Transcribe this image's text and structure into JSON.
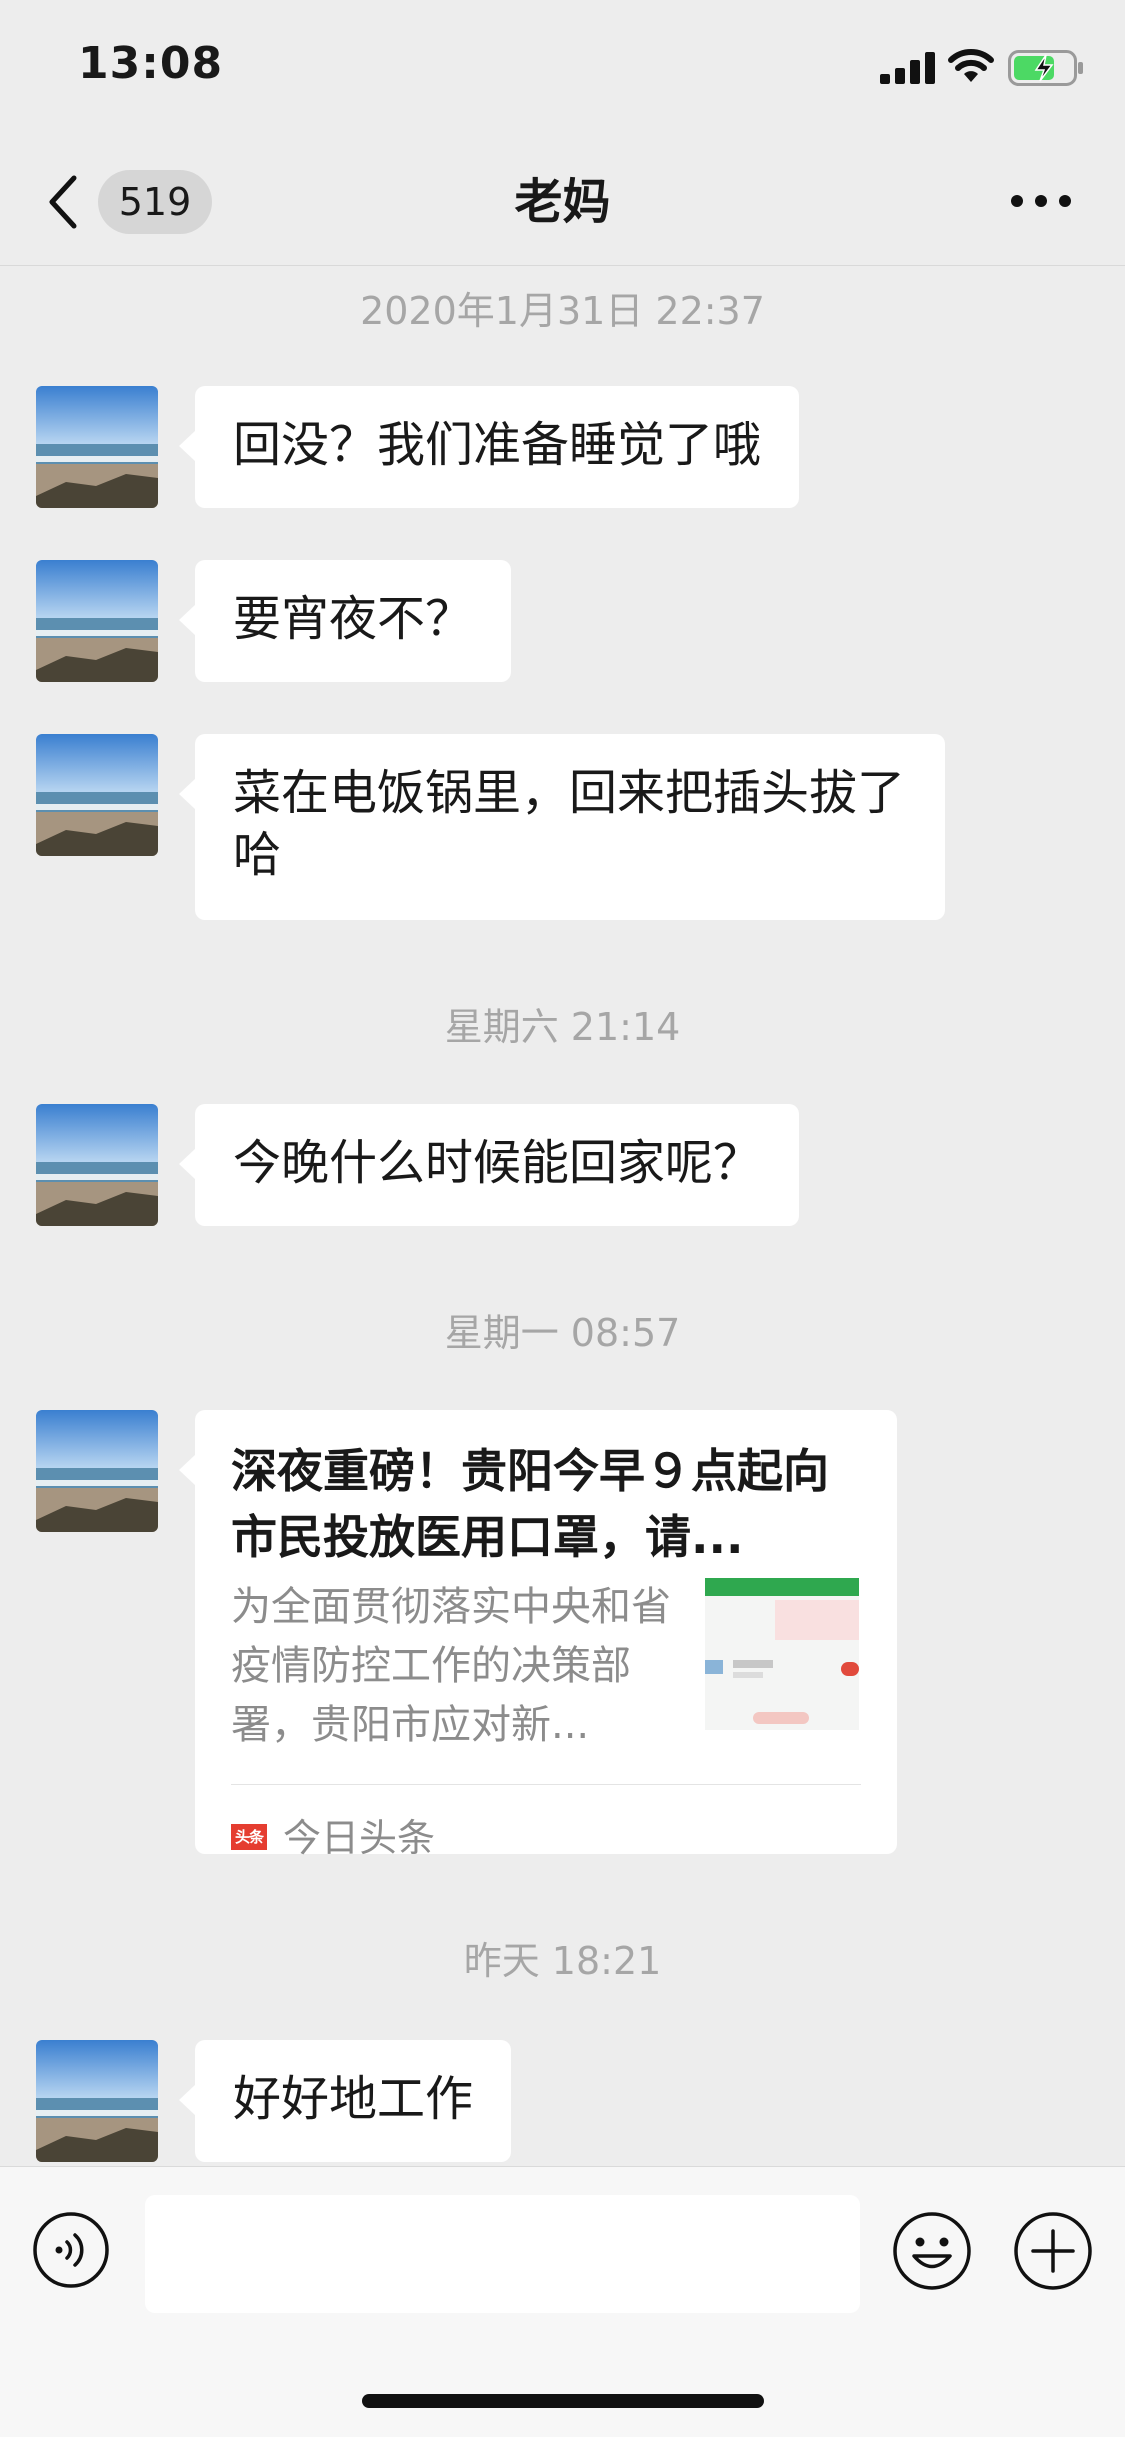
{
  "status_bar": {
    "time": "13:08",
    "battery_charging": true
  },
  "nav": {
    "unread_count": "519",
    "title": "老妈"
  },
  "messages": [
    {
      "type": "timestamp",
      "text": "2020年1月31日 22:37"
    },
    {
      "type": "text",
      "text": "回没？我们准备睡觉了哦"
    },
    {
      "type": "text",
      "text": "要宵夜不？"
    },
    {
      "type": "text",
      "text": "菜在电饭锅里，回来把插头拔了哈"
    },
    {
      "type": "timestamp",
      "text": "星期六 21:14"
    },
    {
      "type": "text",
      "text": "今晚什么时候能回家呢？"
    },
    {
      "type": "timestamp",
      "text": "星期一 08:57"
    },
    {
      "type": "article",
      "title": "深夜重磅！贵阳今早９点起向市民投放医用口罩，请...",
      "description": "为全面贯彻落实中央和省疫情防控工作的决策部署，贵阳市应对新...",
      "source": "今日头条",
      "source_logo_text": "头条"
    },
    {
      "type": "timestamp",
      "text": "昨天 18:21"
    },
    {
      "type": "text",
      "text": "好好地工作"
    }
  ],
  "colors": {
    "background": "#ededed",
    "bubble": "#ffffff",
    "timestamp": "#a6a6a6",
    "source_logo": "#e53d30",
    "battery_fill": "#4cd964"
  },
  "icons": [
    "back-arrow-icon",
    "more-icon",
    "voice-icon",
    "emoji-icon",
    "plus-icon",
    "signal-icon",
    "wifi-icon",
    "battery-icon"
  ]
}
